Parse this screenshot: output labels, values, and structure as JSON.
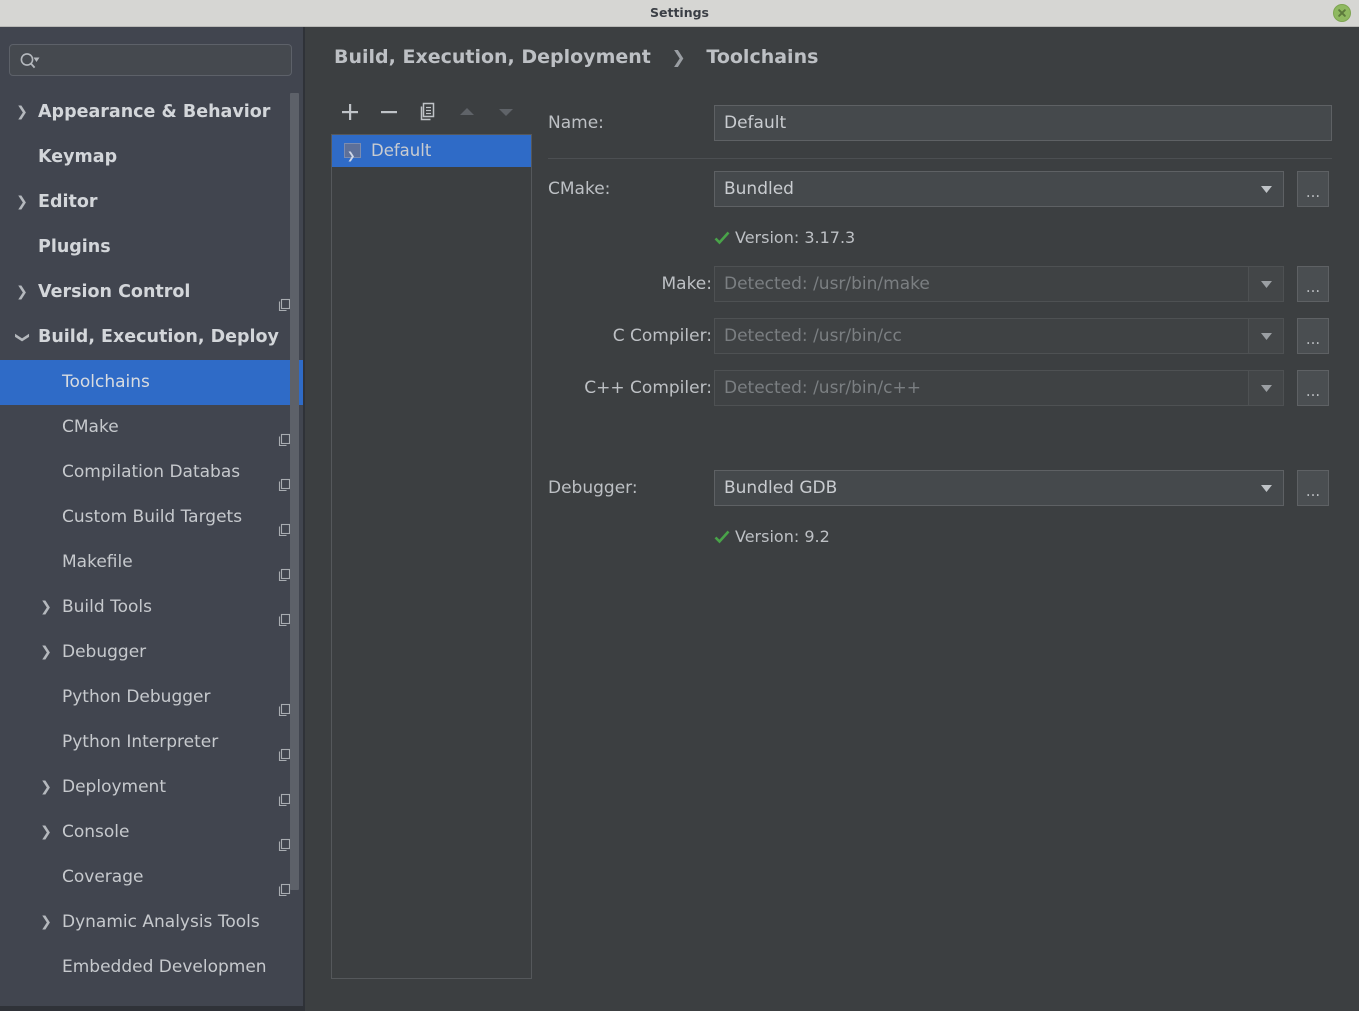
{
  "window": {
    "title": "Settings",
    "close_icon": "close-icon"
  },
  "colors": {
    "titlebar_bg": "#d6d6d3",
    "sidebar_bg": "#41454f",
    "panel_bg": "#3c3f41",
    "selection_blue": "#2f6bc7",
    "text": "#c6c9cd",
    "disabled_text": "#7b7f82",
    "check_green": "#49a349"
  },
  "sidebar": {
    "search": {
      "value": "",
      "placeholder": "",
      "icon": "search-icon"
    },
    "items": [
      {
        "label": "Appearance & Behavior",
        "level": 0,
        "arrow": "collapsed",
        "bold": true,
        "copy_icon": false,
        "selected": false
      },
      {
        "label": "Keymap",
        "level": 0,
        "arrow": "none",
        "bold": true,
        "copy_icon": false,
        "selected": false
      },
      {
        "label": "Editor",
        "level": 0,
        "arrow": "collapsed",
        "bold": true,
        "copy_icon": false,
        "selected": false
      },
      {
        "label": "Plugins",
        "level": 0,
        "arrow": "none",
        "bold": true,
        "copy_icon": false,
        "selected": false
      },
      {
        "label": "Version Control",
        "level": 0,
        "arrow": "collapsed",
        "bold": true,
        "copy_icon": true,
        "selected": false
      },
      {
        "label": "Build, Execution, Deploy",
        "level": 0,
        "arrow": "expanded",
        "bold": true,
        "copy_icon": false,
        "selected": false
      },
      {
        "label": "Toolchains",
        "level": 1,
        "arrow": "none",
        "bold": false,
        "copy_icon": false,
        "selected": true
      },
      {
        "label": "CMake",
        "level": 1,
        "arrow": "none",
        "bold": false,
        "copy_icon": true,
        "selected": false
      },
      {
        "label": "Compilation Databas",
        "level": 1,
        "arrow": "none",
        "bold": false,
        "copy_icon": true,
        "selected": false
      },
      {
        "label": "Custom Build Targets",
        "level": 1,
        "arrow": "none",
        "bold": false,
        "copy_icon": true,
        "selected": false
      },
      {
        "label": "Makefile",
        "level": 1,
        "arrow": "none",
        "bold": false,
        "copy_icon": true,
        "selected": false
      },
      {
        "label": "Build Tools",
        "level": 1,
        "arrow": "collapsed",
        "bold": false,
        "copy_icon": true,
        "selected": false
      },
      {
        "label": "Debugger",
        "level": 1,
        "arrow": "collapsed",
        "bold": false,
        "copy_icon": false,
        "selected": false
      },
      {
        "label": "Python Debugger",
        "level": 1,
        "arrow": "none",
        "bold": false,
        "copy_icon": true,
        "selected": false
      },
      {
        "label": "Python Interpreter",
        "level": 1,
        "arrow": "none",
        "bold": false,
        "copy_icon": true,
        "selected": false
      },
      {
        "label": "Deployment",
        "level": 1,
        "arrow": "collapsed",
        "bold": false,
        "copy_icon": true,
        "selected": false
      },
      {
        "label": "Console",
        "level": 1,
        "arrow": "collapsed",
        "bold": false,
        "copy_icon": true,
        "selected": false
      },
      {
        "label": "Coverage",
        "level": 1,
        "arrow": "none",
        "bold": false,
        "copy_icon": true,
        "selected": false
      },
      {
        "label": "Dynamic Analysis Tools",
        "level": 1,
        "arrow": "collapsed",
        "bold": false,
        "copy_icon": false,
        "selected": false
      },
      {
        "label": "Embedded Developmen",
        "level": 1,
        "arrow": "none",
        "bold": false,
        "copy_icon": false,
        "selected": false
      }
    ]
  },
  "breadcrumb": {
    "parent": "Build, Execution, Deployment",
    "separator": "❯",
    "current": "Toolchains"
  },
  "toolbar": {
    "buttons": [
      {
        "name": "add-toolchain-button",
        "icon": "plus-icon",
        "enabled": true
      },
      {
        "name": "remove-toolchain-button",
        "icon": "minus-icon",
        "enabled": true
      },
      {
        "name": "copy-toolchain-button",
        "icon": "copy-icon",
        "enabled": true
      },
      {
        "name": "move-up-button",
        "icon": "arrow-up-icon",
        "enabled": false
      },
      {
        "name": "move-down-button",
        "icon": "arrow-down-icon",
        "enabled": false
      }
    ]
  },
  "toolchain_list": {
    "items": [
      {
        "label": "Default",
        "icon": "toolchain-icon",
        "selected": true
      }
    ]
  },
  "form": {
    "name": {
      "label": "Name:",
      "value": "Default"
    },
    "cmake": {
      "label": "CMake:",
      "value": "Bundled",
      "browse_label": "...",
      "status": {
        "icon": "check-icon",
        "text": "Version: 3.17.3"
      }
    },
    "make": {
      "label": "Make:",
      "value": "Detected: /usr/bin/make",
      "browse_label": "...",
      "disabled": true
    },
    "c_compiler": {
      "label": "C Compiler:",
      "value": "Detected: /usr/bin/cc",
      "browse_label": "...",
      "disabled": true
    },
    "cxx_compiler": {
      "label": "C++ Compiler:",
      "value": "Detected: /usr/bin/c++",
      "browse_label": "...",
      "disabled": true
    },
    "debugger": {
      "label": "Debugger:",
      "value": "Bundled GDB",
      "browse_label": "...",
      "status": {
        "icon": "check-icon",
        "text": "Version: 9.2"
      }
    }
  }
}
